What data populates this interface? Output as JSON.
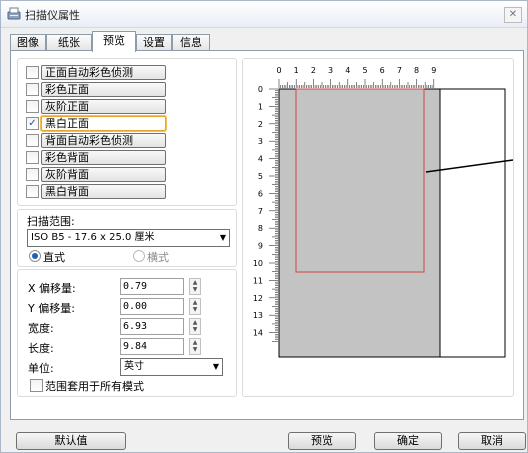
{
  "window": {
    "title": "扫描仪属性",
    "close_label": "✕"
  },
  "tabs": [
    "图像",
    "纸张",
    "预览",
    "设置",
    "信息"
  ],
  "image_types": [
    {
      "label": "正面自动彩色侦测",
      "checked": false,
      "selected": false
    },
    {
      "label": "彩色正面",
      "checked": false,
      "selected": false
    },
    {
      "label": "灰阶正面",
      "checked": false,
      "selected": false
    },
    {
      "label": "黑白正面",
      "checked": true,
      "selected": true
    },
    {
      "label": "背面自动彩色侦测",
      "checked": false,
      "selected": false
    },
    {
      "label": "彩色背面",
      "checked": false,
      "selected": false
    },
    {
      "label": "灰阶背面",
      "checked": false,
      "selected": false
    },
    {
      "label": "黑白背面",
      "checked": false,
      "selected": false
    }
  ],
  "scan_area": {
    "label": "扫描范围:",
    "value": "ISO B5 - 17.6 x 25.0 厘米",
    "orientation": {
      "portrait": "直式",
      "landscape": "横式",
      "selected": "portrait"
    }
  },
  "offsets": {
    "x_label": "X 偏移量:",
    "x_value": "0.79",
    "y_label": "Y 偏移量:",
    "y_value": "0.00",
    "width_label": "宽度:",
    "width_value": "6.93",
    "length_label": "长度:",
    "length_value": "9.84",
    "unit_label": "单位:",
    "unit_value": "英寸",
    "apply_all_label": "范围套用于所有模式",
    "apply_all_checked": false
  },
  "preview": {
    "ruler_x": [
      "0",
      "1",
      "2",
      "3",
      "4",
      "5",
      "6",
      "7",
      "8",
      "9"
    ],
    "ruler_y": [
      "0",
      "1",
      "2",
      "3",
      "4",
      "5",
      "6",
      "7",
      "8",
      "9",
      "10",
      "11",
      "12",
      "13",
      "14"
    ]
  },
  "buttons": {
    "default": "默认值",
    "preview": "预览",
    "ok": "确定",
    "cancel": "取消"
  },
  "colors": {
    "accent_red": "#d34545",
    "page_gray": "#c3c3c3",
    "focus_orange": "#e8a431"
  }
}
